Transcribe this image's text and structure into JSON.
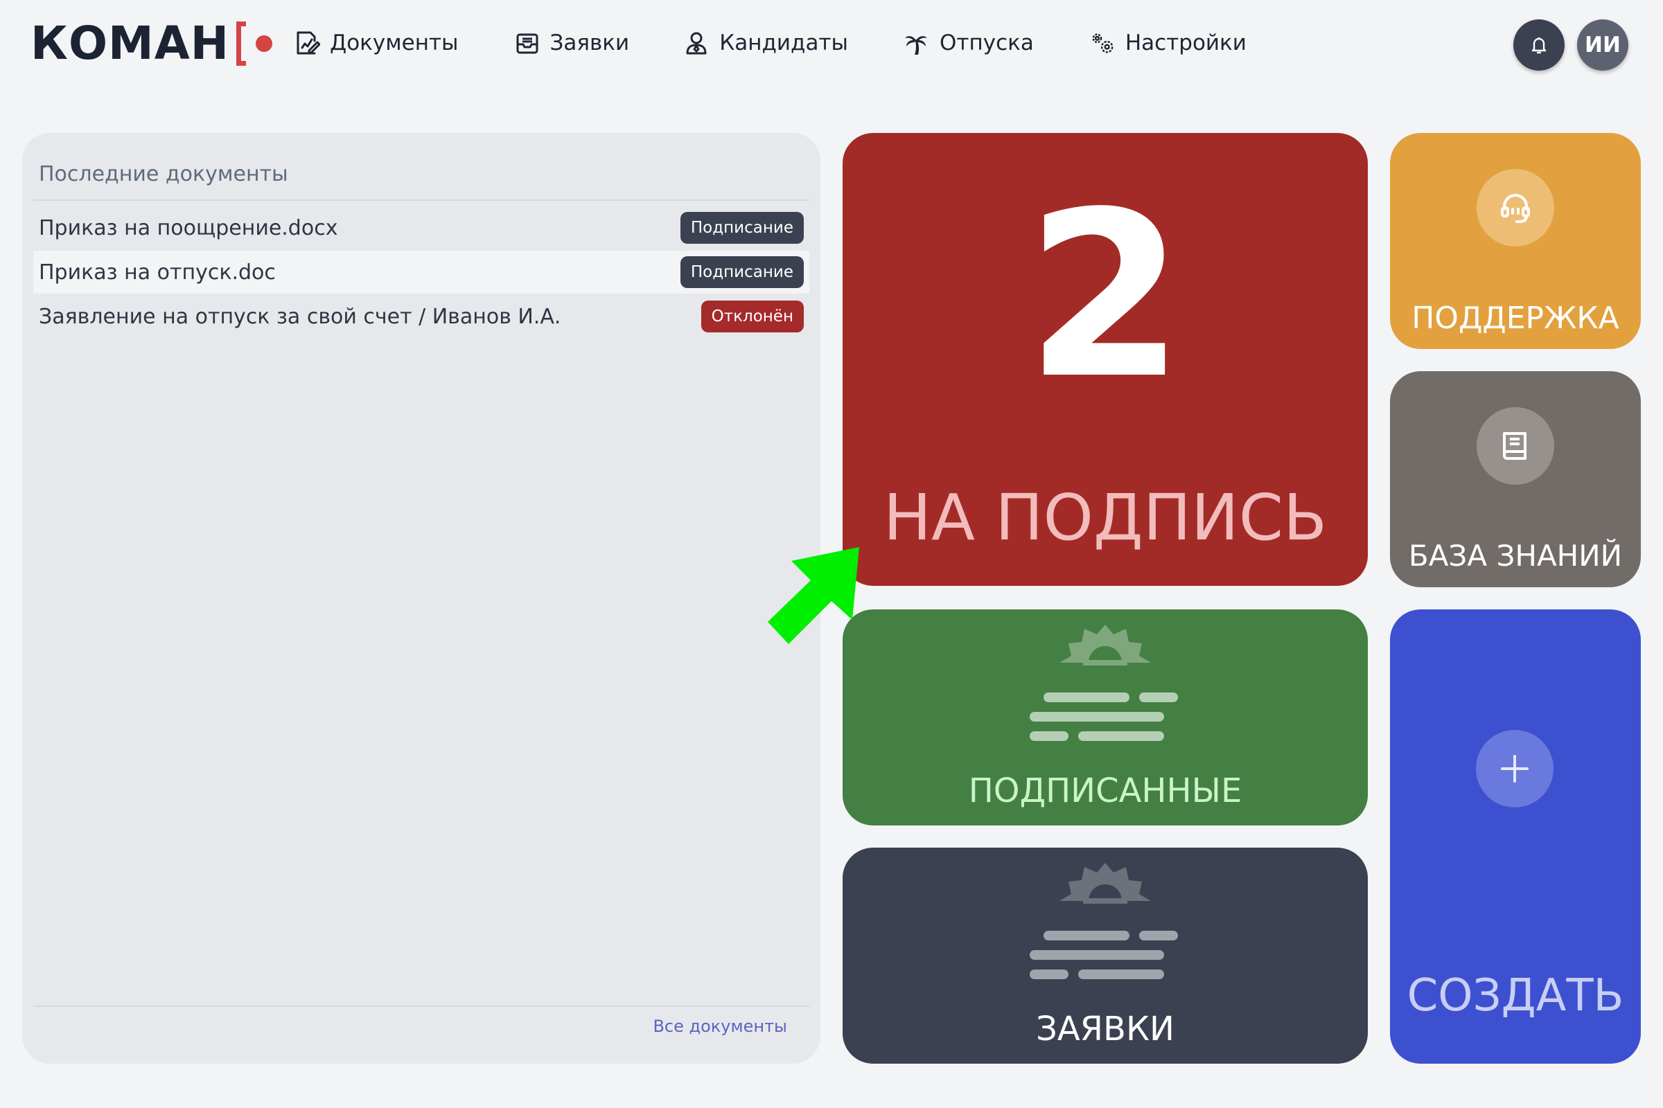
{
  "header": {
    "logo_text": "КОМАН",
    "nav": [
      {
        "label": "Документы",
        "icon": "document-edit-icon"
      },
      {
        "label": "Заявки",
        "icon": "inbox-tray-icon"
      },
      {
        "label": "Кандидаты",
        "icon": "user-candidate-icon"
      },
      {
        "label": "Отпуска",
        "icon": "palm-tree-icon"
      },
      {
        "label": "Настройки",
        "icon": "gears-icon"
      }
    ],
    "notifications_icon": "bell-icon",
    "avatar_initials": "ИИ"
  },
  "recent_docs": {
    "title": "Последние документы",
    "items": [
      {
        "name": "Приказ на поощрение.docx",
        "status": "Подписание",
        "status_type": "dark"
      },
      {
        "name": "Приказ на отпуск.doc",
        "status": "Подписание",
        "status_type": "dark"
      },
      {
        "name": "Заявление на отпуск за свой счет / Иванов И.А.",
        "status": "Отклонён",
        "status_type": "red"
      }
    ],
    "all_docs_link": "Все документы"
  },
  "tiles": {
    "to_sign": {
      "count": "2",
      "label": "НА ПОДПИСЬ",
      "color": "#a32b27"
    },
    "signed": {
      "label": "ПОДПИСАННЫЕ",
      "color": "#447f43",
      "icon": "sun-horizon-icon"
    },
    "requests": {
      "label": "ЗАЯВКИ",
      "color": "#3b4150",
      "icon": "sun-horizon-icon"
    },
    "support": {
      "label": "ПОДДЕРЖКА",
      "color": "#e2a13e",
      "icon": "headset-icon"
    },
    "knowledge_base": {
      "label": "БАЗА ЗНАНИЙ",
      "color": "#726c69",
      "icon": "book-icon"
    },
    "create": {
      "label": "СОЗДАТЬ",
      "color": "#3d51d0",
      "icon": "plus-icon"
    }
  },
  "annotation": {
    "icon": "green-pointer-arrow-icon",
    "color": "#00ee00"
  }
}
